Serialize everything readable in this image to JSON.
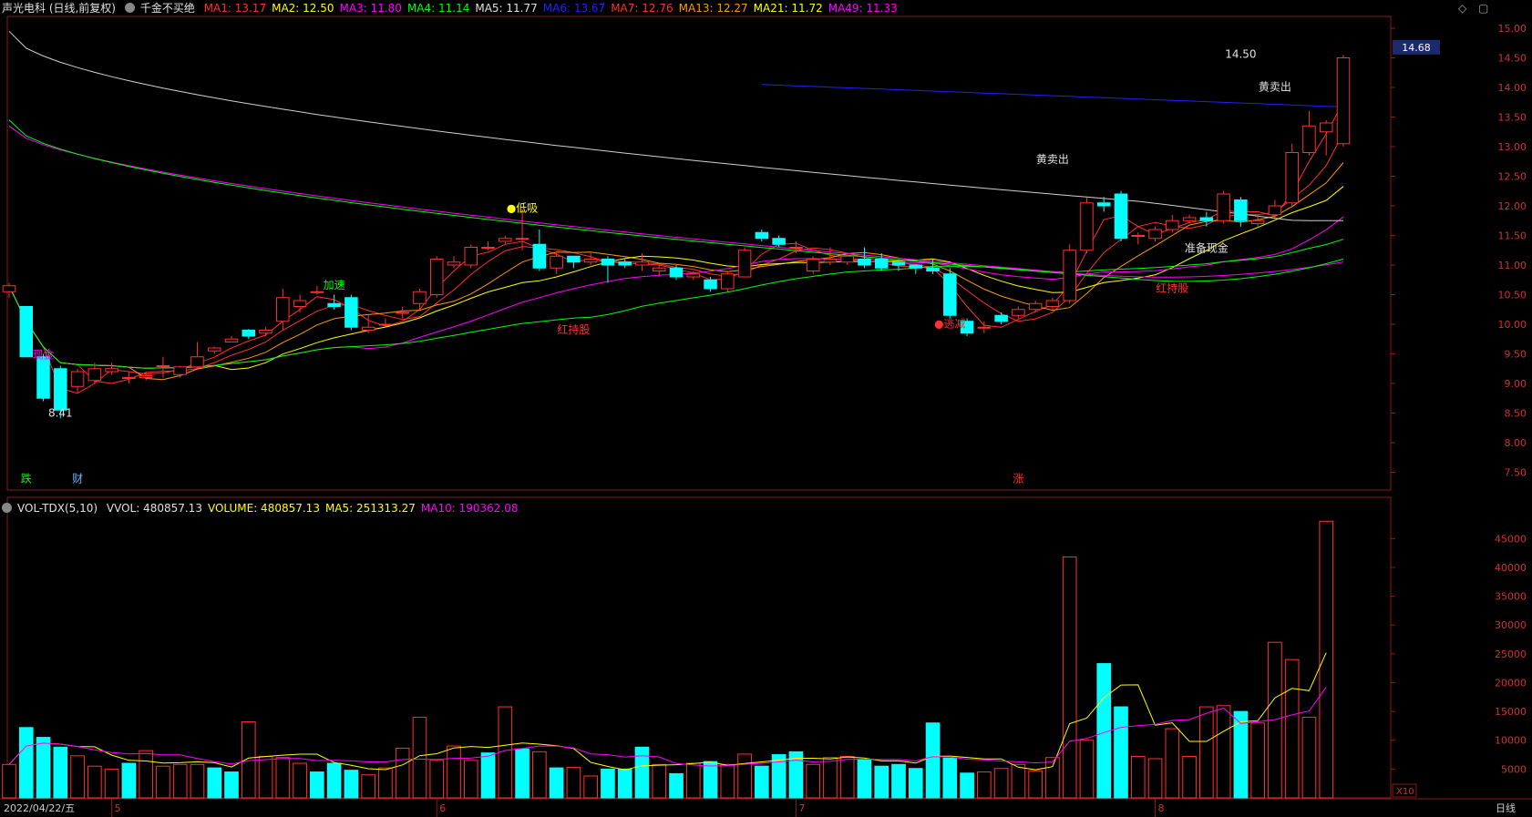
{
  "header": {
    "stock_title": "声光电科 (日线,前复权)",
    "indicator_name": "千金不买绝",
    "ma_items": [
      {
        "label": "MA1: 13.17",
        "color": "#ff3030"
      },
      {
        "label": "MA2: 12.50",
        "color": "#ffff00"
      },
      {
        "label": "MA3: 11.80",
        "color": "#ff00ff"
      },
      {
        "label": "MA4: 11.14",
        "color": "#00ff00"
      },
      {
        "label": "MA5: 11.77",
        "color": "#e0e0e0"
      },
      {
        "label": "MA6: 13.67",
        "color": "#2020ff"
      },
      {
        "label": "MA7: 12.76",
        "color": "#ff3030"
      },
      {
        "label": "MA13: 12.27",
        "color": "#ff9900"
      },
      {
        "label": "MA21: 11.72",
        "color": "#ffff00"
      },
      {
        "label": "MA49: 11.33",
        "color": "#ff00ff"
      }
    ]
  },
  "volume_header": {
    "name": "VOL-TDX(5,10)",
    "items": [
      {
        "label": "VVOL: 480857.13",
        "color": "#e0e0e0"
      },
      {
        "label": "VOLUME: 480857.13",
        "color": "#ffff00"
      },
      {
        "label": "MA5: 251313.27",
        "color": "#ffff00"
      },
      {
        "label": "MA10: 190362.08",
        "color": "#ff00ff"
      }
    ]
  },
  "current_price_label": "14.68",
  "volume_unit_label": "X10",
  "period_label": "日线",
  "date_axis": {
    "start": "2022/04/22/五",
    "month_marks": [
      {
        "label": "5",
        "i": 6
      },
      {
        "label": "6",
        "i": 25
      },
      {
        "label": "7",
        "i": 46
      },
      {
        "label": "8",
        "i": 67
      }
    ]
  },
  "annotations": [
    {
      "text": "8.41",
      "color": "#e0e0e0",
      "i": 3,
      "price": 8.44
    },
    {
      "text": "加速",
      "color": "#00ff00",
      "i": 19,
      "price": 10.6
    },
    {
      "text": "●低吸",
      "color": "#ffff00",
      "i": 30,
      "price": 11.9
    },
    {
      "text": "红持股",
      "color": "#ff3030",
      "i": 33,
      "price": 9.85
    },
    {
      "text": "●逃减",
      "color": "#ff3030",
      "i": 55,
      "price": 9.95
    },
    {
      "text": "黄卖出",
      "color": "#e0e0e0",
      "i": 61,
      "price": 12.72
    },
    {
      "text": "准备现金",
      "color": "#e0e0e0",
      "i": 70,
      "price": 11.22
    },
    {
      "text": "红持股",
      "color": "#ff3030",
      "i": 68,
      "price": 10.55
    },
    {
      "text": "黄卖出",
      "color": "#e0e0e0",
      "i": 74,
      "price": 13.95
    },
    {
      "text": "14.50",
      "color": "#e0e0e0",
      "i": 72,
      "price": 14.5
    },
    {
      "text": "跌",
      "color": "#00ff00",
      "i": 1,
      "price": 7.33
    },
    {
      "text": "财",
      "color": "#6fb4ff",
      "i": 4,
      "price": 7.33
    },
    {
      "text": "涨",
      "color": "#ff3030",
      "i": 59,
      "price": 7.33
    },
    {
      "text": "现金",
      "color": "#ff00ff",
      "i": 2,
      "price": 9.42
    }
  ],
  "chart_data": {
    "type": "candlestick",
    "title": "声光电科 (日线,前复权)",
    "price_axis": {
      "ticks": [
        7.5,
        8.0,
        8.5,
        9.0,
        9.5,
        10.0,
        10.5,
        11.0,
        11.5,
        12.0,
        12.5,
        13.0,
        13.5,
        14.0,
        14.5,
        15.0
      ],
      "range": [
        7.2,
        15.2
      ]
    },
    "volume_axis": {
      "ticks": [
        5000,
        10000,
        15000,
        20000,
        25000,
        30000,
        35000,
        40000,
        45000
      ],
      "range": [
        0,
        49000
      ]
    },
    "candles": [
      [
        10.55,
        10.65,
        10.45,
        10.7
      ],
      [
        10.3,
        9.45,
        9.45,
        10.3
      ],
      [
        9.45,
        8.75,
        8.7,
        9.5
      ],
      [
        9.25,
        8.55,
        8.41,
        9.3
      ],
      [
        8.95,
        9.2,
        8.85,
        9.25
      ],
      [
        9.05,
        9.25,
        9.0,
        9.35
      ],
      [
        9.2,
        9.25,
        9.15,
        9.35
      ],
      [
        9.1,
        9.1,
        9.0,
        9.2
      ],
      [
        9.1,
        9.13,
        9.05,
        9.2
      ],
      [
        9.3,
        9.3,
        9.1,
        9.45
      ],
      [
        9.15,
        9.28,
        9.1,
        9.3
      ],
      [
        9.28,
        9.45,
        9.25,
        9.7
      ],
      [
        9.55,
        9.6,
        9.5,
        9.62
      ],
      [
        9.7,
        9.75,
        9.7,
        9.8
      ],
      [
        9.9,
        9.8,
        9.75,
        9.92
      ],
      [
        9.85,
        9.9,
        9.8,
        9.95
      ],
      [
        10.05,
        10.45,
        9.9,
        10.6
      ],
      [
        10.3,
        10.4,
        10.2,
        10.5
      ],
      [
        10.55,
        10.55,
        10.5,
        10.65
      ],
      [
        10.35,
        10.3,
        10.25,
        10.5
      ],
      [
        10.45,
        9.95,
        9.9,
        10.5
      ],
      [
        9.9,
        9.95,
        9.85,
        10.15
      ],
      [
        10.0,
        10.0,
        9.95,
        10.1
      ],
      [
        10.2,
        10.2,
        10.1,
        10.3
      ],
      [
        10.35,
        10.55,
        10.25,
        10.6
      ],
      [
        10.5,
        11.1,
        10.45,
        11.15
      ],
      [
        11.0,
        11.05,
        10.95,
        11.15
      ],
      [
        11.0,
        11.3,
        10.95,
        11.35
      ],
      [
        11.3,
        11.3,
        11.25,
        11.4
      ],
      [
        11.4,
        11.45,
        11.35,
        11.5
      ],
      [
        11.45,
        11.45,
        11.25,
        11.95
      ],
      [
        11.35,
        10.95,
        10.9,
        11.6
      ],
      [
        10.95,
        11.15,
        10.85,
        11.2
      ],
      [
        11.15,
        11.05,
        10.95,
        11.15
      ],
      [
        11.05,
        11.1,
        11.0,
        11.2
      ],
      [
        11.1,
        11.0,
        10.7,
        11.15
      ],
      [
        11.05,
        11.0,
        10.95,
        11.1
      ],
      [
        11.0,
        11.05,
        10.9,
        11.2
      ],
      [
        10.9,
        10.95,
        10.8,
        11.0
      ],
      [
        10.95,
        10.8,
        10.75,
        11.0
      ],
      [
        10.8,
        10.85,
        10.75,
        10.9
      ],
      [
        10.75,
        10.6,
        10.55,
        10.8
      ],
      [
        10.6,
        10.85,
        10.55,
        10.9
      ],
      [
        10.8,
        11.25,
        10.8,
        11.3
      ],
      [
        11.55,
        11.45,
        11.4,
        11.6
      ],
      [
        11.45,
        11.35,
        11.3,
        11.5
      ],
      [
        11.3,
        11.3,
        11.2,
        11.4
      ],
      [
        10.9,
        11.1,
        10.85,
        11.15
      ],
      [
        11.05,
        11.1,
        11.0,
        11.3
      ],
      [
        11.05,
        11.15,
        11.0,
        11.2
      ],
      [
        11.1,
        11.0,
        10.95,
        11.3
      ],
      [
        11.1,
        10.95,
        10.9,
        11.2
      ],
      [
        11.05,
        11.0,
        10.9,
        11.1
      ],
      [
        11.0,
        10.95,
        10.85,
        11.0
      ],
      [
        10.95,
        10.9,
        10.85,
        11.1
      ],
      [
        10.85,
        10.15,
        10.1,
        10.95
      ],
      [
        10.05,
        9.85,
        9.8,
        10.1
      ],
      [
        9.95,
        9.95,
        9.85,
        10.05
      ],
      [
        10.15,
        10.05,
        10.0,
        10.2
      ],
      [
        10.15,
        10.25,
        10.1,
        10.3
      ],
      [
        10.25,
        10.35,
        10.2,
        10.4
      ],
      [
        10.3,
        10.4,
        10.25,
        10.45
      ],
      [
        10.4,
        11.25,
        10.35,
        11.35
      ],
      [
        11.25,
        12.05,
        11.2,
        12.15
      ],
      [
        12.05,
        12.0,
        11.9,
        12.15
      ],
      [
        12.2,
        11.45,
        11.4,
        12.25
      ],
      [
        11.5,
        11.5,
        11.35,
        11.55
      ],
      [
        11.45,
        11.6,
        11.4,
        11.65
      ],
      [
        11.6,
        11.75,
        11.55,
        11.85
      ],
      [
        11.75,
        11.8,
        11.7,
        11.85
      ],
      [
        11.8,
        11.75,
        11.65,
        11.9
      ],
      [
        11.75,
        12.2,
        11.7,
        12.25
      ],
      [
        12.1,
        11.75,
        11.65,
        12.15
      ],
      [
        11.7,
        11.75,
        11.65,
        11.85
      ],
      [
        11.85,
        12.0,
        11.8,
        12.1
      ],
      [
        12.05,
        12.9,
        12.0,
        13.05
      ],
      [
        12.9,
        13.35,
        12.85,
        13.6
      ],
      [
        13.25,
        13.4,
        12.85,
        13.45
      ],
      [
        13.05,
        14.5,
        13.0,
        14.55
      ]
    ],
    "candle_fields": [
      "open",
      "close",
      "low",
      "high"
    ],
    "volume": [
      5800,
      12200,
      10500,
      8800,
      7300,
      5500,
      5000,
      6000,
      8200,
      5500,
      5800,
      5800,
      5200,
      4500,
      13200,
      7200,
      7000,
      6000,
      4500,
      6000,
      4800,
      4000,
      5200,
      8600,
      14000,
      6500,
      9000,
      6500,
      7800,
      15800,
      8500,
      8000,
      5200,
      5300,
      3800,
      5000,
      5000,
      8800,
      5800,
      4200,
      6000,
      6300,
      5800,
      7600,
      5500,
      7500,
      8000,
      5800,
      7000,
      7200,
      6600,
      5500,
      5800,
      5100,
      13000,
      6900,
      4300,
      4500,
      5100,
      5800,
      4700,
      7000,
      41800,
      10000,
      23300,
      15800,
      7200,
      6800,
      12000,
      7200,
      15800,
      16000,
      15000,
      13000,
      27000,
      24000,
      14000,
      48000
    ],
    "volume_color": [
      "up",
      "down",
      "down",
      "down",
      "up",
      "up",
      "up",
      "down",
      "up",
      "up",
      "up",
      "up",
      "down",
      "down",
      "up",
      "up",
      "up",
      "up",
      "down",
      "down",
      "down",
      "up",
      "up",
      "up",
      "up",
      "up",
      "up",
      "up",
      "down",
      "up",
      "down",
      "up",
      "down",
      "up",
      "up",
      "down",
      "down",
      "down",
      "up",
      "down",
      "up",
      "down",
      "up",
      "up",
      "down",
      "down",
      "down",
      "up",
      "up",
      "up",
      "down",
      "down",
      "down",
      "down",
      "down",
      "down",
      "down",
      "up",
      "up",
      "up",
      "up",
      "up",
      "up",
      "up",
      "down",
      "down",
      "up",
      "up",
      "up",
      "up",
      "up",
      "up",
      "down",
      "up",
      "up",
      "up",
      "up",
      "up"
    ],
    "series": [
      {
        "name": "MA1",
        "color": "#ff3030"
      },
      {
        "name": "MA2",
        "color": "#ffff00"
      },
      {
        "name": "MA3",
        "color": "#ff00ff"
      },
      {
        "name": "MA4",
        "color": "#00ff00"
      },
      {
        "name": "MA5",
        "color": "#e0e0e0"
      },
      {
        "name": "MA6",
        "color": "#2020ff"
      },
      {
        "name": "MA7",
        "color": "#ff3030"
      },
      {
        "name": "MA13",
        "color": "#ff9900"
      },
      {
        "name": "MA21",
        "color": "#ffff00"
      },
      {
        "name": "MA49",
        "color": "#ff00ff"
      }
    ]
  }
}
